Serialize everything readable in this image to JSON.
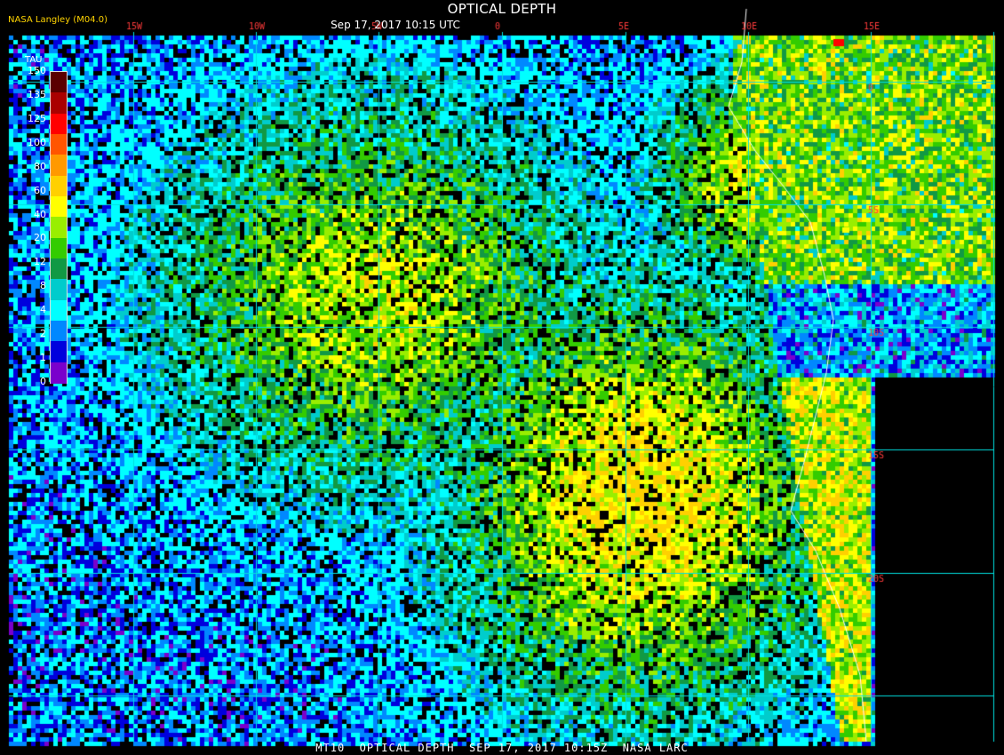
{
  "header": {
    "title": "OPTICAL DEPTH",
    "subtitle": "Sep 17, 2017 10:15 UTC",
    "credit": "NASA Langley (M04.0)"
  },
  "footer": {
    "caption": "MT10  OPTICAL DEPTH  SEP 17, 2017 10:15Z  NASA LARC"
  },
  "legend": {
    "title": "TAU",
    "ticks": [
      "150",
      "135",
      "125",
      "100",
      "80",
      "60",
      "40",
      "20",
      "12",
      "8",
      "4",
      "2",
      "1",
      "0"
    ],
    "colors": [
      "#5a0000",
      "#aa0000",
      "#ff0000",
      "#ff5500",
      "#ff9900",
      "#ffd000",
      "#ffff00",
      "#99ee00",
      "#33cc00",
      "#119944",
      "#00cccc",
      "#00ffff",
      "#0088ff",
      "#0000dd",
      "#7a00cc"
    ]
  },
  "map": {
    "grid_color": "#00e0e0",
    "longitude_labels": [
      "15W",
      "10W",
      "5W",
      "0",
      "5E",
      "10E",
      "15E"
    ],
    "latitude_labels": [
      "0",
      "5S",
      "10S",
      "15S",
      "20S"
    ],
    "coastline_color": "#ffffff",
    "label_color": "#ff3b3b"
  }
}
